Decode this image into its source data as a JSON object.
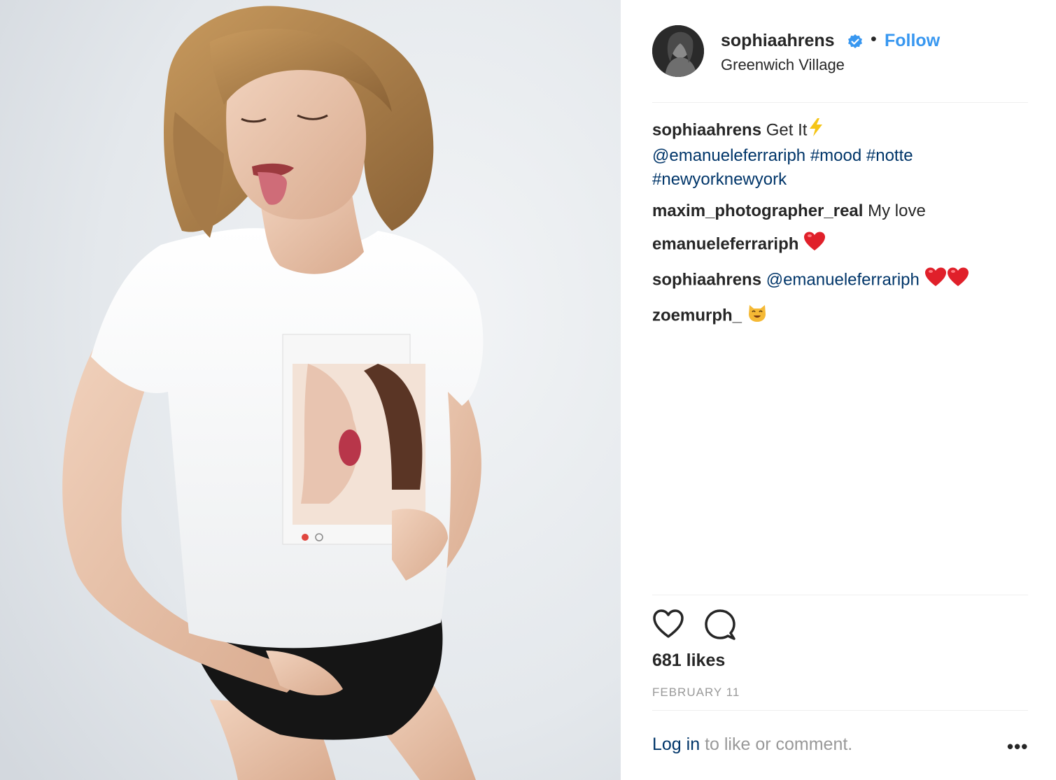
{
  "post": {
    "username": "sophiaahrens",
    "separator": "•",
    "follow_label": "Follow",
    "location": "Greenwich Village",
    "icons": {
      "verified": "verified-badge-icon",
      "like": "heart-outline-icon",
      "comment": "comment-bubble-icon",
      "more": "more-options-icon"
    },
    "colors": {
      "link_blue": "#3897f0",
      "hashtag": "#003569",
      "muted": "#999999",
      "text": "#262626",
      "heart_emoji": "#e0202a"
    }
  },
  "caption": {
    "username": "sophiaahrens",
    "text": "Get It",
    "emoji": "⚡",
    "mention": "@emanueleferrariph",
    "tags": [
      "#mood",
      "#notte",
      "#newyorknewyork"
    ]
  },
  "comments": [
    {
      "username": "maxim_photographer_real",
      "text": "My love"
    },
    {
      "username": "emanueleferrariph",
      "text": "",
      "emoji": "❤️"
    },
    {
      "username": "sophiaahrens",
      "text": "@emanueleferrariph",
      "emoji": "❤️❤️"
    },
    {
      "username": "zoemurph_",
      "text": "",
      "emoji": "😺"
    }
  ],
  "stats": {
    "likes": "681 likes",
    "date": "FEBRUARY 11"
  },
  "footer": {
    "login_label": "Log in",
    "login_suffix": " to like or comment.",
    "more_label": "•••"
  }
}
